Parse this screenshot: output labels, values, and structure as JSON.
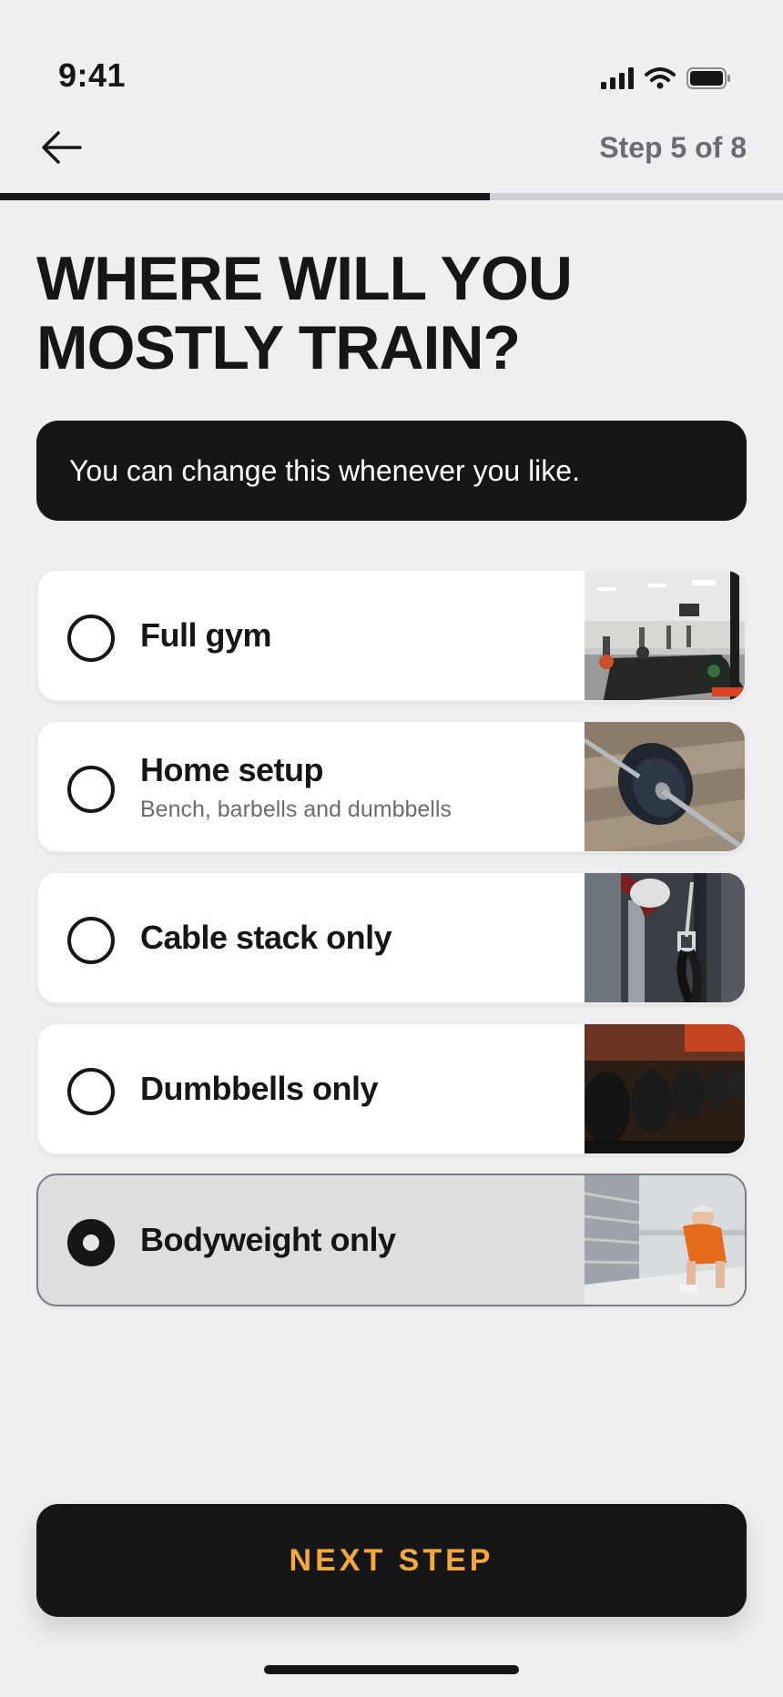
{
  "status_bar": {
    "time": "9:41",
    "icons": [
      "signal-icon",
      "wifi-icon",
      "battery-icon"
    ]
  },
  "nav": {
    "back_icon": "arrow-left-icon",
    "step_label": "Step 5 of 8"
  },
  "progress": {
    "fraction": 0.625,
    "fill_color": "#161618",
    "track_color": "#cfcfd3"
  },
  "headline": "WHERE WILL YOU MOSTLY TRAIN?",
  "info_banner": "You can change this whenever you like.",
  "options": [
    {
      "title": "Full gym",
      "subtitle": "",
      "selected": false,
      "image": "gym-interior-photo"
    },
    {
      "title": "Home setup",
      "subtitle": "Bench, barbells and dumbbells",
      "selected": false,
      "image": "barbell-on-floor-photo"
    },
    {
      "title": "Cable stack only",
      "subtitle": "",
      "selected": false,
      "image": "cable-machine-photo"
    },
    {
      "title": "Dumbbells only",
      "subtitle": "",
      "selected": false,
      "image": "dumbbell-rack-photo"
    },
    {
      "title": "Bodyweight only",
      "subtitle": "",
      "selected": true,
      "image": "push-up-photo"
    }
  ],
  "next_button": {
    "label": "NEXT STEP",
    "label_color": "#f5a93b"
  },
  "colors": {
    "background": "#efeff1",
    "dark": "#161618",
    "accent": "#f5a93b"
  }
}
